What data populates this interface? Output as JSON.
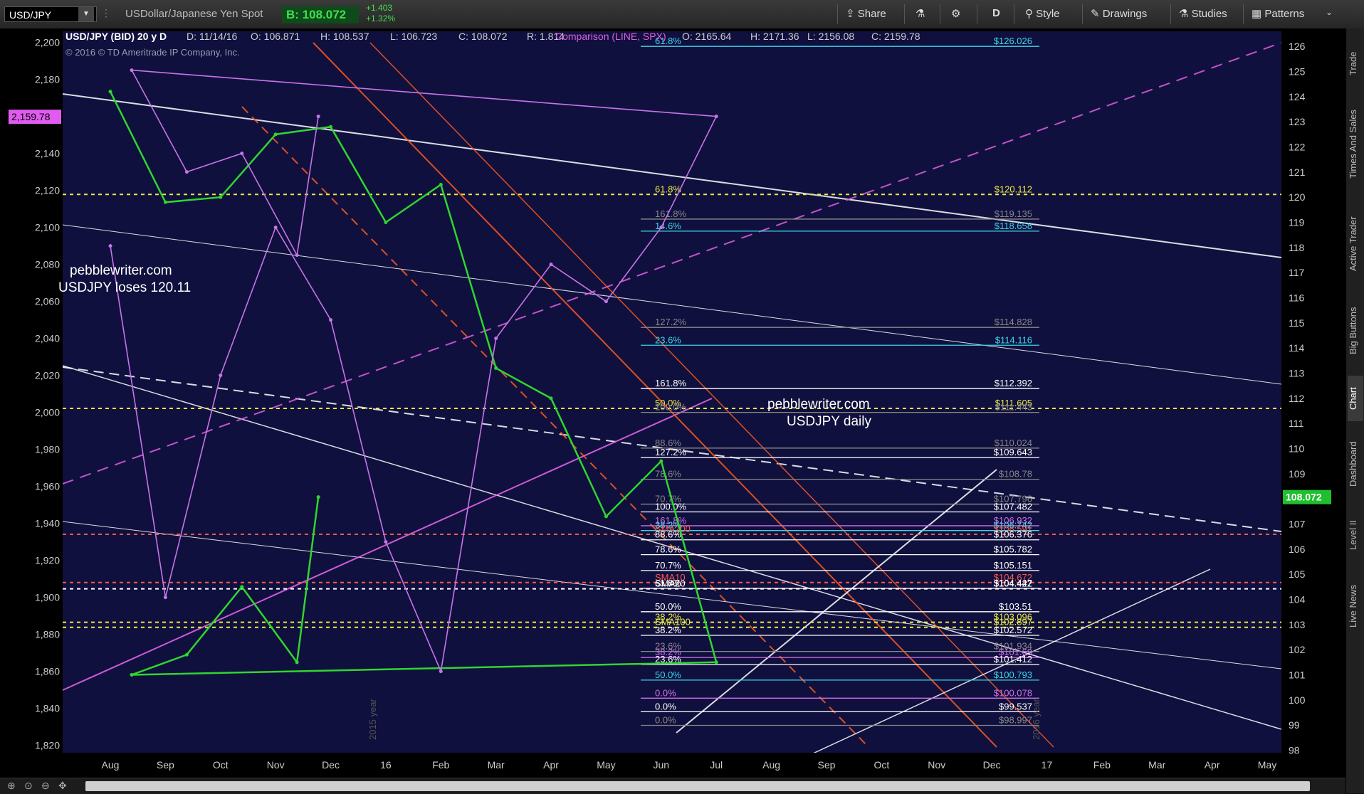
{
  "toolbar": {
    "symbol": "USD/JPY",
    "description": "USDollar/Japanese Yen Spot",
    "bid": "B: 108.072",
    "change_abs": "+1.403",
    "change_pct": "+1.32%",
    "share": "Share",
    "timeframe": "D",
    "style": "Style",
    "drawings": "Drawings",
    "studies": "Studies",
    "patterns": "Patterns"
  },
  "header": {
    "ticker": "USD/JPY (BID) 20 y D",
    "date": "D: 11/14/16",
    "open": "O: 106.871",
    "high": "H: 108.537",
    "low": "L: 106.723",
    "close": "C: 108.072",
    "range": "R: 1.814",
    "comparison": "Comparison (LINE, SPX)",
    "cmp_open": "O: 2165.64",
    "cmp_high": "H: 2171.36",
    "cmp_low": "L: 2156.08",
    "cmp_close": "C: 2159.78",
    "copyright": "© 2016 © TD Ameritrade IP Company, Inc."
  },
  "annotations": {
    "note1_line1": "pebblewriter.com",
    "note1_line2": "USDJPY loses 120.11",
    "note2_line1": "pebblewriter.com",
    "note2_line2": "USDJPY daily",
    "year_2015": "2015 year",
    "year_2016": "2016 year"
  },
  "sidebar": [
    "Trade",
    "Times And Sales",
    "Active Trader",
    "Big Buttons",
    "Chart",
    "Dashboard",
    "Level II",
    "Live News"
  ],
  "chart_data": {
    "type": "line",
    "title": "USD/JPY (BID) 20 y D",
    "x_ticks": [
      "Aug",
      "Sep",
      "Oct",
      "Nov",
      "Dec",
      "16",
      "Feb",
      "Mar",
      "Apr",
      "May",
      "Jun",
      "Jul",
      "Aug",
      "Sep",
      "Oct",
      "Nov",
      "Dec",
      "17",
      "Feb",
      "Mar",
      "Apr",
      "May"
    ],
    "y_right_ticks": [
      98,
      99,
      100,
      101,
      102,
      103,
      104,
      105,
      106,
      107,
      108,
      109,
      110,
      111,
      112,
      113,
      114,
      115,
      116,
      117,
      118,
      119,
      120,
      121,
      122,
      123,
      124,
      125,
      126
    ],
    "y_left_ticks": [
      1820,
      1840,
      1860,
      1880,
      1900,
      1920,
      1940,
      1960,
      1980,
      2000,
      2020,
      2040,
      2060,
      2080,
      2100,
      2120,
      2140,
      2160,
      2180,
      2200
    ],
    "y_right_range": [
      97.9,
      126.6
    ],
    "y_left_range": [
      1816,
      2206
    ],
    "last_price_label": "108.072",
    "spx_last_label": "2,159.78",
    "series": [
      {
        "name": "USD/JPY",
        "color": "#2fd62f",
        "x": [
          "Aug",
          "Sep",
          "Oct",
          "Nov",
          "Dec",
          "16",
          "Feb",
          "Mar",
          "Apr",
          "May",
          "Jun",
          "Jul",
          "Aug",
          "Sep",
          "Oct",
          "Nov",
          "Nov"
        ],
        "values": [
          124.2,
          119.8,
          120.0,
          122.5,
          122.8,
          119.0,
          120.5,
          113.2,
          112.0,
          107.3,
          109.5,
          101.5,
          101.0,
          101.8,
          104.5,
          101.5,
          108.07
        ]
      },
      {
        "name": "SPX",
        "color": "#c774e8",
        "x": [
          "Aug",
          "Sep",
          "Oct",
          "Nov",
          "Dec",
          "16",
          "Feb",
          "Mar",
          "Apr",
          "May",
          "Jun",
          "Jul",
          "Aug",
          "Sep",
          "Oct",
          "Nov",
          "Nov"
        ],
        "values": [
          2090,
          1900,
          2020,
          2100,
          2050,
          1930,
          1860,
          2040,
          2080,
          2060,
          2100,
          2160,
          2185,
          2130,
          2140,
          2085,
          2160
        ]
      }
    ],
    "levels": [
      {
        "label": "$126.026",
        "value": 126.0,
        "color": "#3cd6e8",
        "left": "61.8%"
      },
      {
        "label": "$120.112",
        "value": 120.11,
        "color": "#e8e84a",
        "left": "61.8%"
      },
      {
        "label": "$119.135",
        "value": 119.13,
        "color": "#888888",
        "left": "161.8%"
      },
      {
        "label": "$118.658",
        "value": 118.65,
        "color": "#3cd6e8",
        "left": "14.6%"
      },
      {
        "label": "$114.828",
        "value": 114.82,
        "color": "#888888",
        "left": "127.2%"
      },
      {
        "label": "$114.116",
        "value": 114.11,
        "color": "#3cd6e8",
        "left": "23.6%"
      },
      {
        "label": "$112.392",
        "value": 112.39,
        "color": "#ffffff",
        "left": "161.8%"
      },
      {
        "label": "$111.605",
        "value": 111.6,
        "color": "#e8e84a",
        "left": "50.0%"
      },
      {
        "label": "$111.443",
        "value": 111.44,
        "color": "#888888",
        "left": "100.0%"
      },
      {
        "label": "$110.024",
        "value": 110.02,
        "color": "#888888",
        "left": "88.6%"
      },
      {
        "label": "$109.643",
        "value": 109.64,
        "color": "#ffffff",
        "left": "127.2%"
      },
      {
        "label": "$108.78",
        "value": 108.78,
        "color": "#888888",
        "left": "78.6%"
      },
      {
        "label": "$107.796",
        "value": 107.79,
        "color": "#888888",
        "left": "70.7%"
      },
      {
        "label": "$107.482",
        "value": 107.48,
        "color": "#ffffff",
        "left": "100.0%"
      },
      {
        "label": "$106.932",
        "value": 106.93,
        "color": "#d070e8",
        "left": "161.8%"
      },
      {
        "label": "$106.742",
        "value": 106.74,
        "color": "#3cd6e8",
        "left": "38.2%"
      },
      {
        "label": "$106.591",
        "value": 106.59,
        "color": "#ff5a4a",
        "left": "SMA200"
      },
      {
        "label": "$106.376",
        "value": 106.37,
        "color": "#ffffff",
        "left": "88.6%"
      },
      {
        "label": "$105.782",
        "value": 105.78,
        "color": "#ffffff",
        "left": "78.6%"
      },
      {
        "label": "$105.151",
        "value": 105.15,
        "color": "#ffffff",
        "left": "70.7%"
      },
      {
        "label": "$104.672",
        "value": 104.67,
        "color": "#ff5a4a",
        "left": "SMA10"
      },
      {
        "label": "$104.447",
        "value": 104.44,
        "color": "#ffffff",
        "left": "61.8%"
      },
      {
        "label": "$104.422",
        "value": 104.42,
        "color": "#ffffff",
        "left": "SMA20"
      },
      {
        "label": "$103.51",
        "value": 103.51,
        "color": "#ffffff",
        "left": "50.0%"
      },
      {
        "label": "$103.096",
        "value": 103.09,
        "color": "#e8e84a",
        "left": "38.2%"
      },
      {
        "label": "$102.897",
        "value": 102.89,
        "color": "#e8e84a",
        "left": "SMA100"
      },
      {
        "label": "$102.572",
        "value": 102.57,
        "color": "#ffffff",
        "left": "38.2%"
      },
      {
        "label": "$101.934",
        "value": 101.93,
        "color": "#888888",
        "left": "23.6%"
      },
      {
        "label": "$101.69",
        "value": 101.69,
        "color": "#d070e8",
        "left": "38.2%"
      },
      {
        "label": "$101.412",
        "value": 101.41,
        "color": "#ffffff",
        "left": "23.6%"
      },
      {
        "label": "$100.793",
        "value": 100.79,
        "color": "#3cd6e8",
        "left": "50.0%"
      },
      {
        "label": "$100.078",
        "value": 100.07,
        "color": "#d070e8",
        "left": "0.0%"
      },
      {
        "label": "$99.537",
        "value": 99.53,
        "color": "#ffffff",
        "left": "0.0%"
      },
      {
        "label": "$98.997",
        "value": 98.99,
        "color": "#888888",
        "left": "0.0%"
      }
    ]
  }
}
